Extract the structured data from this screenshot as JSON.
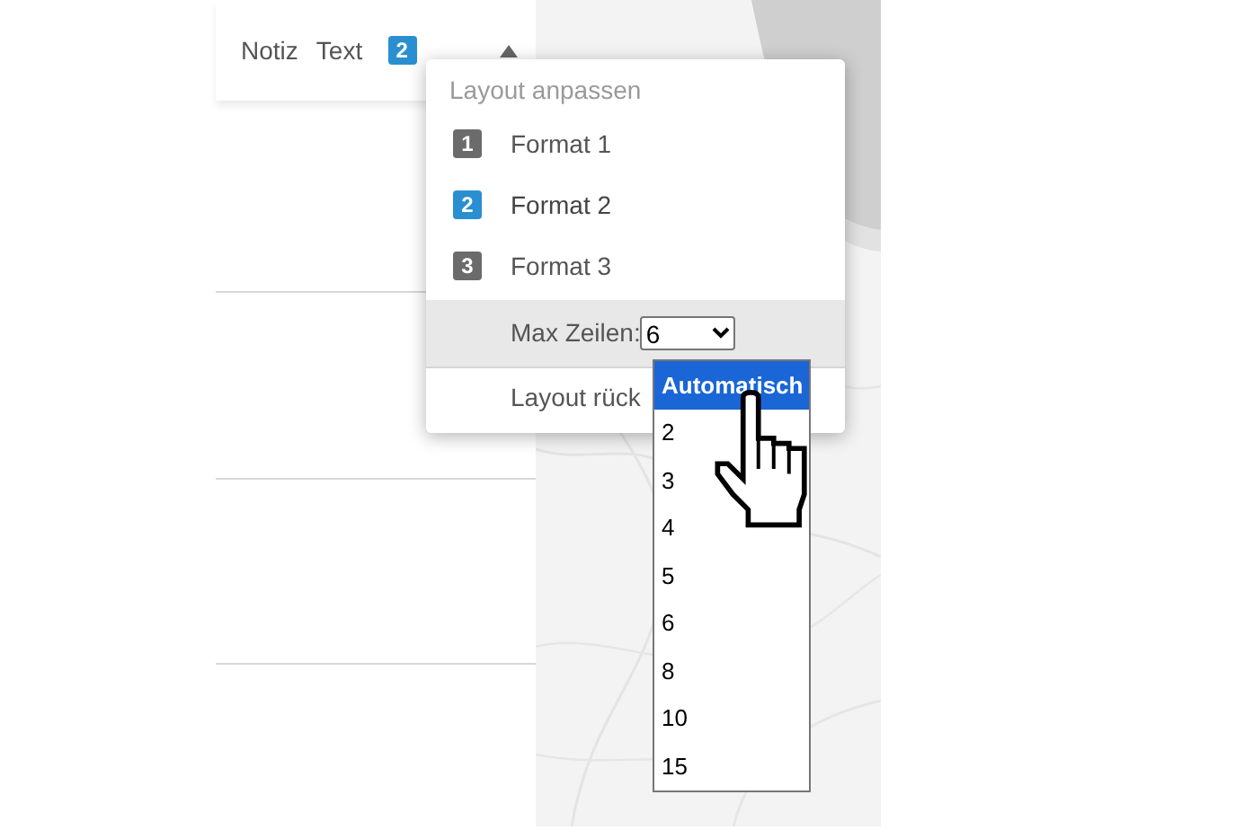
{
  "toolbar": {
    "items": [
      "Notiz",
      "Text"
    ],
    "layout_badge": "2"
  },
  "layout_menu": {
    "title": "Layout anpassen",
    "formats": [
      {
        "badge": "1",
        "label": "Format 1",
        "selected": false
      },
      {
        "badge": "2",
        "label": "Format 2",
        "selected": true
      },
      {
        "badge": "3",
        "label": "Format 3",
        "selected": false
      }
    ],
    "max_rows": {
      "label": "Max Zeilen:",
      "value": "6"
    },
    "reset": "Layout rück"
  },
  "row_dropdown": {
    "options": [
      {
        "label": "Automatisch",
        "selected": true
      },
      {
        "label": "2",
        "selected": false
      },
      {
        "label": "3",
        "selected": false
      },
      {
        "label": "4",
        "selected": false
      },
      {
        "label": "5",
        "selected": false
      },
      {
        "label": "6",
        "selected": false
      },
      {
        "label": "8",
        "selected": false
      },
      {
        "label": "10",
        "selected": false
      },
      {
        "label": "15",
        "selected": false
      }
    ]
  }
}
